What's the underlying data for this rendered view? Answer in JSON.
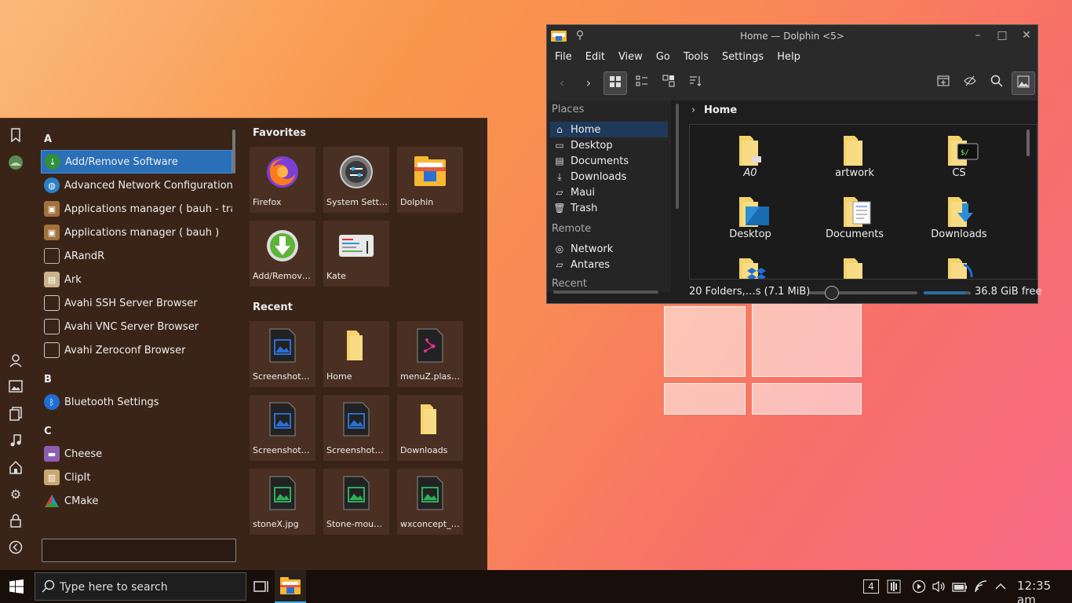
{
  "menu": {
    "sections": [
      {
        "letter": "A",
        "items": [
          {
            "label": "Add/Remove Software",
            "icon": "download-icon",
            "selected": true
          },
          {
            "label": "Advanced Network Configuration",
            "icon": "globe-icon"
          },
          {
            "label": "Applications manager ( bauh - tray",
            "icon": "package-icon"
          },
          {
            "label": "Applications manager ( bauh )",
            "icon": "package-icon"
          },
          {
            "label": "ARandR",
            "icon": "document-icon"
          },
          {
            "label": "Ark",
            "icon": "archive-icon"
          },
          {
            "label": "Avahi SSH Server Browser",
            "icon": "monitor-icon"
          },
          {
            "label": "Avahi VNC Server Browser",
            "icon": "monitor-icon"
          },
          {
            "label": "Avahi Zeroconf Browser",
            "icon": "monitor-icon"
          }
        ]
      },
      {
        "letter": "B",
        "items": [
          {
            "label": "Bluetooth Settings",
            "icon": "bluetooth-icon"
          }
        ]
      },
      {
        "letter": "C",
        "items": [
          {
            "label": "Cheese",
            "icon": "webcam-icon"
          },
          {
            "label": "ClipIt",
            "icon": "clipboard-icon"
          },
          {
            "label": "CMake",
            "icon": "triangle-icon"
          }
        ]
      }
    ],
    "favorites_title": "Favorites",
    "favorites": [
      {
        "label": "Firefox",
        "icon": "firefox-icon"
      },
      {
        "label": "System Setti…",
        "icon": "settings-icon"
      },
      {
        "label": "Dolphin",
        "icon": "dolphin-icon"
      },
      {
        "label": "Add/Remov…",
        "icon": "download-icon"
      },
      {
        "label": "Kate",
        "icon": "kate-icon"
      }
    ],
    "recent_title": "Recent",
    "recent": [
      {
        "label": "Screenshot_…",
        "icon": "image-file-icon"
      },
      {
        "label": "Home",
        "icon": "folder-icon"
      },
      {
        "label": "menuZ.plas…",
        "icon": "plasmoid-icon"
      },
      {
        "label": "Screenshot_…",
        "icon": "image-file-icon"
      },
      {
        "label": "Screenshot_…",
        "icon": "image-file-icon"
      },
      {
        "label": "Downloads",
        "icon": "folder-icon"
      },
      {
        "label": "stoneX.jpg",
        "icon": "image-green-icon"
      },
      {
        "label": "Stone-moun…",
        "icon": "image-green-icon"
      },
      {
        "label": "wxconcept_…",
        "icon": "image-green-icon"
      }
    ],
    "search_placeholder": ""
  },
  "dolphin": {
    "title": "Home — Dolphin <5>",
    "menu": [
      "File",
      "Edit",
      "View",
      "Go",
      "Tools",
      "Settings",
      "Help"
    ],
    "places_header": "Places",
    "places": [
      {
        "label": "Home",
        "icon": "home-icon",
        "selected": true
      },
      {
        "label": "Desktop",
        "icon": "desktop-icon"
      },
      {
        "label": "Documents",
        "icon": "documents-icon"
      },
      {
        "label": "Downloads",
        "icon": "downloads-icon"
      },
      {
        "label": "Maui",
        "icon": "folder-icon"
      },
      {
        "label": "Trash",
        "icon": "trash-icon"
      }
    ],
    "remote_header": "Remote",
    "remote": [
      {
        "label": "Network",
        "icon": "network-icon"
      },
      {
        "label": "Antares",
        "icon": "folder-icon"
      }
    ],
    "recent_header": "Recent",
    "breadcrumb": "Home",
    "files": [
      {
        "label": "A0",
        "badge": "link"
      },
      {
        "label": "artwork",
        "badge": ""
      },
      {
        "label": "CS",
        "badge": "terminal"
      },
      {
        "label": "Desktop",
        "badge": "desktop"
      },
      {
        "label": "Documents",
        "badge": "document"
      },
      {
        "label": "Downloads",
        "badge": "download"
      }
    ],
    "status_text": "20 Folders,…s (7.1 MiB)",
    "free_space": "36.8 GiB free",
    "accent": "#3daee9"
  },
  "taskbar": {
    "search_placeholder": "Type here to search",
    "desktop_number": "4",
    "clock": "12:35 am"
  }
}
